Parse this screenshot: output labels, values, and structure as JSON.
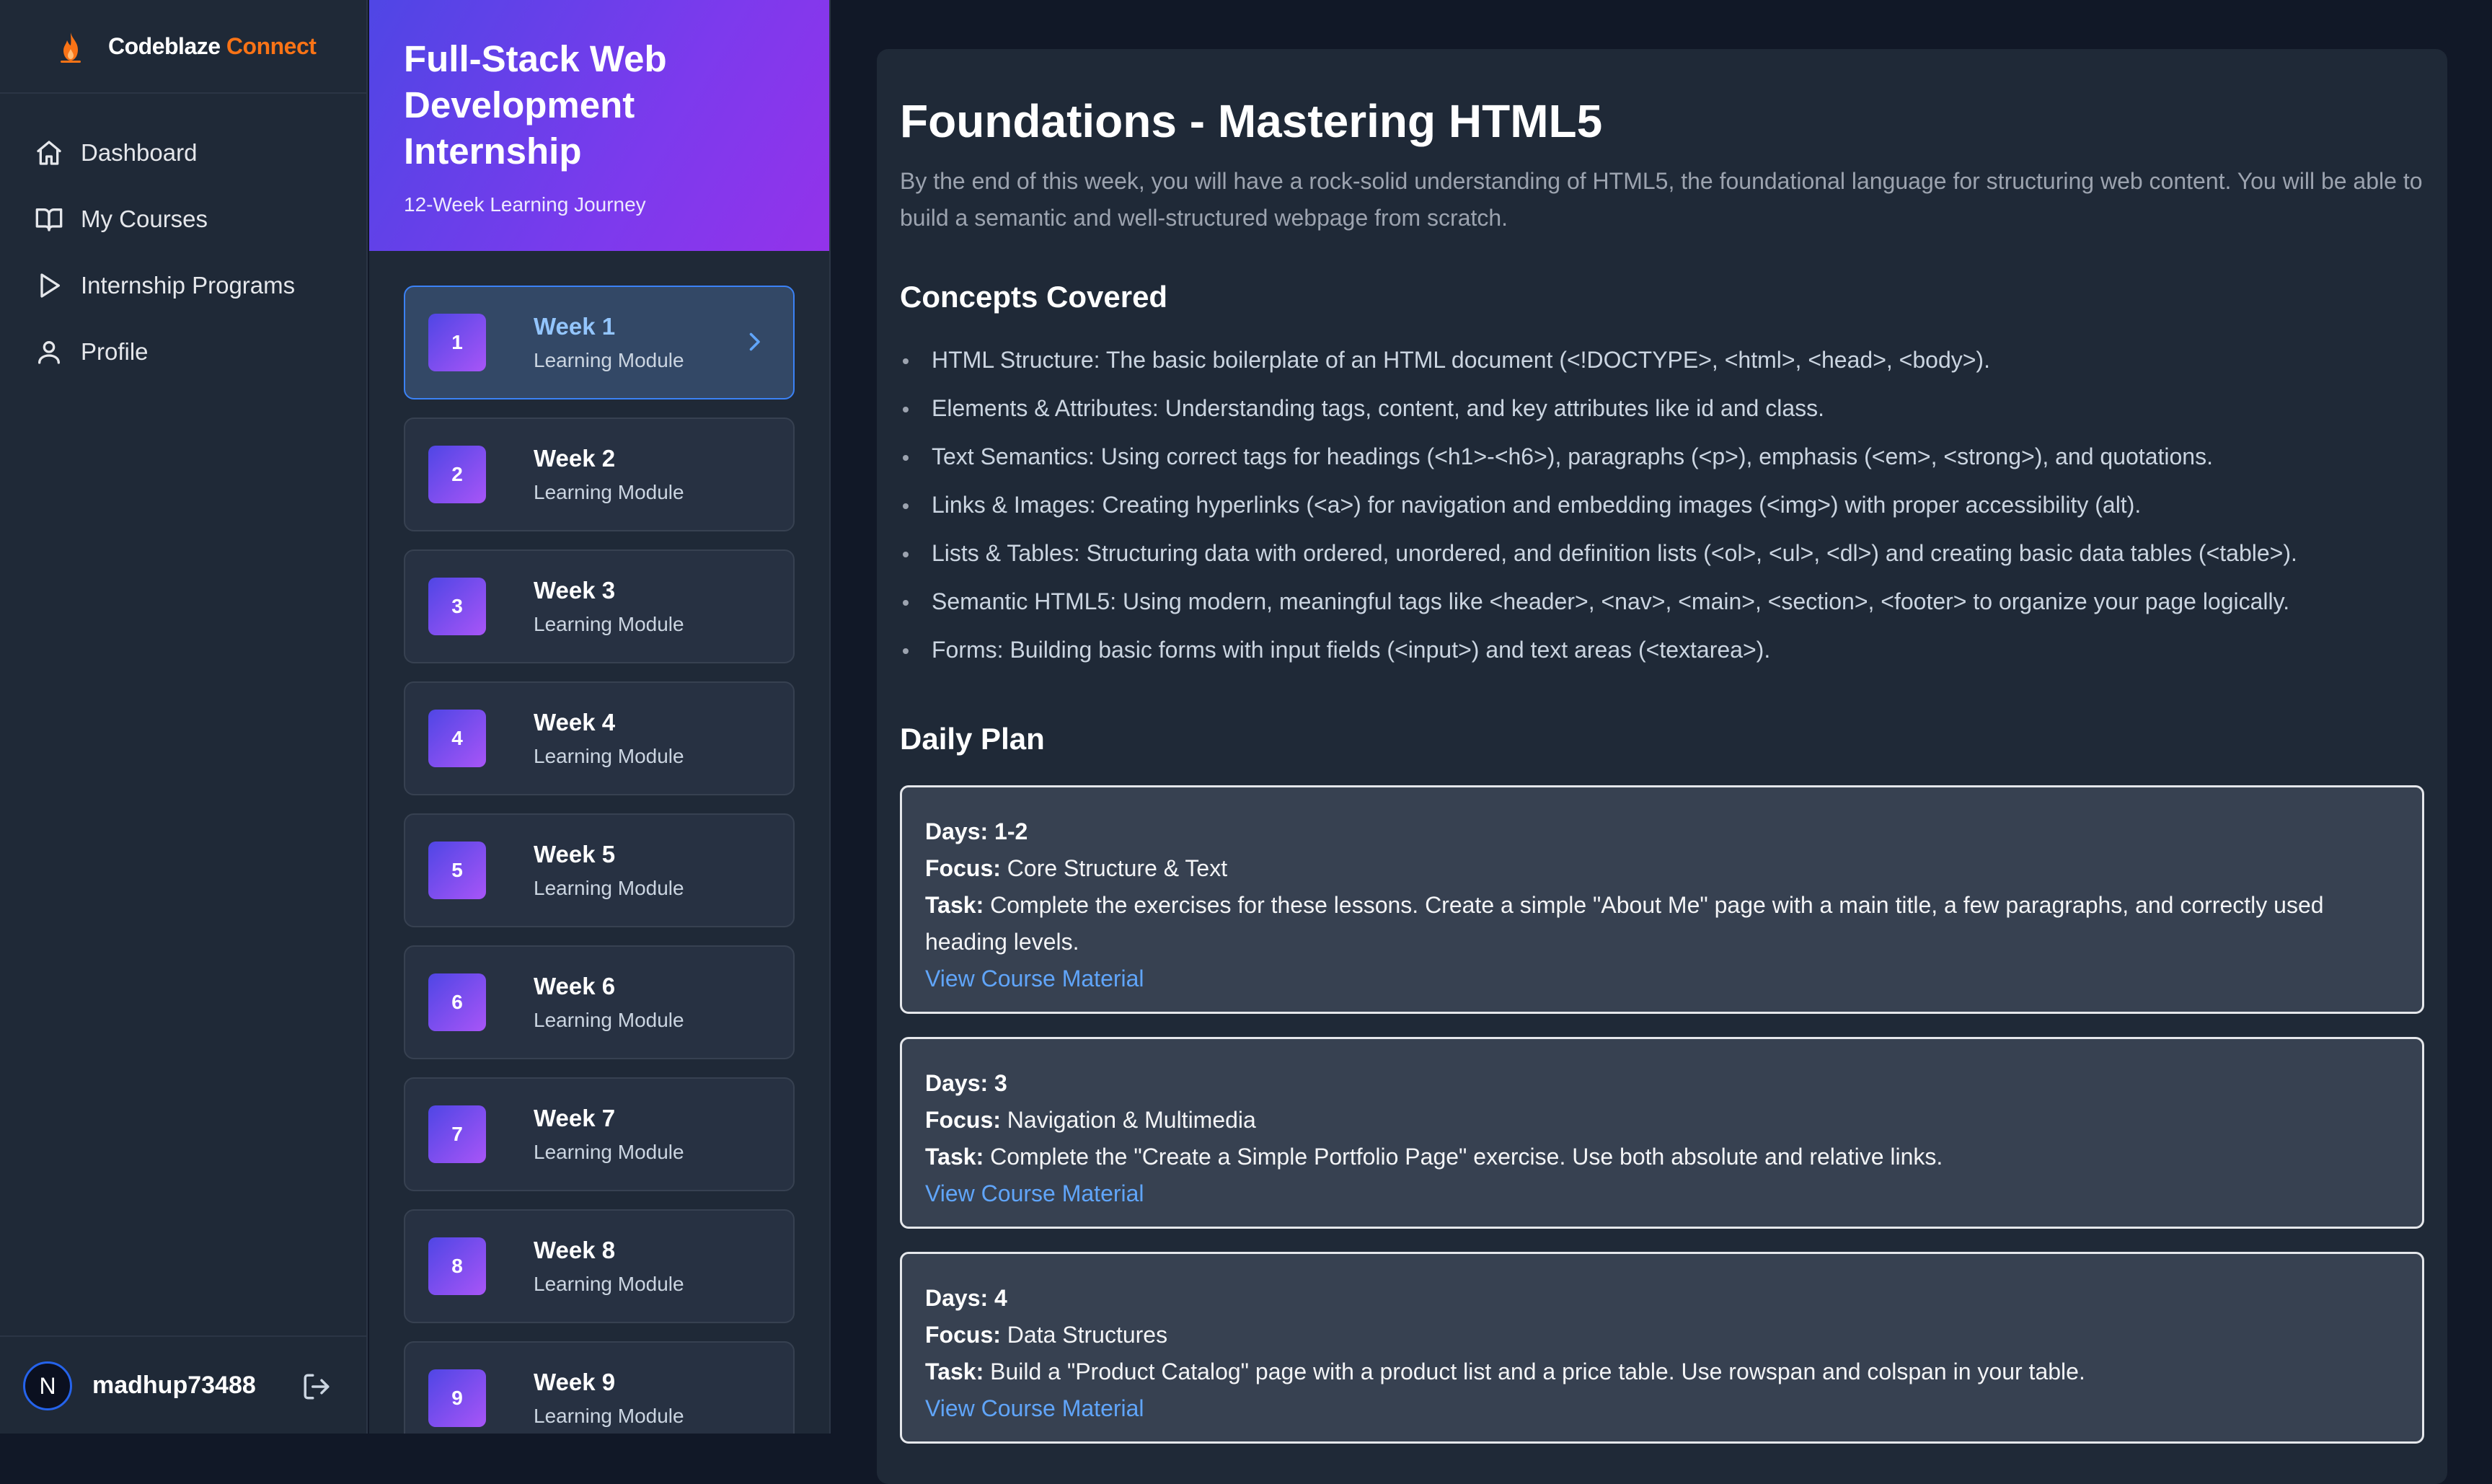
{
  "brand": {
    "name": "Codeblaze",
    "accent": "Connect"
  },
  "nav": [
    {
      "label": "Dashboard"
    },
    {
      "label": "My Courses"
    },
    {
      "label": "Internship Programs"
    },
    {
      "label": "Profile"
    }
  ],
  "user": {
    "initial": "N",
    "name": "madhup73488"
  },
  "course": {
    "title": "Full-Stack Web Development Internship",
    "subtitle": "12-Week Learning Journey"
  },
  "weeks": [
    {
      "num": "1",
      "title": "Week 1",
      "sub": "Learning Module",
      "active": true
    },
    {
      "num": "2",
      "title": "Week 2",
      "sub": "Learning Module"
    },
    {
      "num": "3",
      "title": "Week 3",
      "sub": "Learning Module"
    },
    {
      "num": "4",
      "title": "Week 4",
      "sub": "Learning Module"
    },
    {
      "num": "5",
      "title": "Week 5",
      "sub": "Learning Module"
    },
    {
      "num": "6",
      "title": "Week 6",
      "sub": "Learning Module"
    },
    {
      "num": "7",
      "title": "Week 7",
      "sub": "Learning Module"
    },
    {
      "num": "8",
      "title": "Week 8",
      "sub": "Learning Module"
    },
    {
      "num": "9",
      "title": "Week 9",
      "sub": "Learning Module"
    }
  ],
  "module": {
    "title": "Foundations - Mastering HTML5",
    "intro": "By the end of this week, you will have a rock-solid understanding of HTML5, the foundational language for structuring web content. You will be able to build a semantic and well-structured webpage from scratch.",
    "concepts_heading": "Concepts Covered",
    "concepts": [
      "HTML Structure: The basic boilerplate of an HTML document (<!DOCTYPE>, <html>, <head>, <body>).",
      "Elements & Attributes: Understanding tags, content, and key attributes like id and class.",
      "Text Semantics: Using correct tags for headings (<h1>-<h6>), paragraphs (<p>), emphasis (<em>, <strong>), and quotations.",
      "Links & Images: Creating hyperlinks (<a>) for navigation and embedding images (<img>) with proper accessibility (alt).",
      "Lists & Tables: Structuring data with ordered, unordered, and definition lists (<ol>, <ul>, <dl>) and creating basic data tables (<table>).",
      "Semantic HTML5: Using modern, meaningful tags like <header>, <nav>, <main>, <section>, <footer> to organize your page logically.",
      "Forms: Building basic forms with input fields (<input>) and text areas (<textarea>)."
    ],
    "daily_heading": "Daily Plan",
    "labels": {
      "days": "Days:",
      "focus": "Focus:",
      "task": "Task:"
    },
    "plan": [
      {
        "days": "1-2",
        "focus": "Core Structure & Text",
        "task": "Complete the exercises for these lessons. Create a simple \"About Me\" page with a main title, a few paragraphs, and correctly used heading levels.",
        "link": "View Course Material"
      },
      {
        "days": "3",
        "focus": "Navigation & Multimedia",
        "task": "Complete the \"Create a Simple Portfolio Page\" exercise. Use both absolute and relative links.",
        "link": "View Course Material"
      },
      {
        "days": "4",
        "focus": "Data Structures",
        "task": "Build a \"Product Catalog\" page with a product list and a price table. Use rowspan and colspan in your table.",
        "link": "View Course Material"
      }
    ]
  },
  "colors": {
    "sidebar_bg": "#1f2937",
    "page_bg": "#111827",
    "accent_orange": "#f97316",
    "accent_blue": "#60a5fa",
    "header_gradient": "#4f46e5-#9333ea"
  }
}
